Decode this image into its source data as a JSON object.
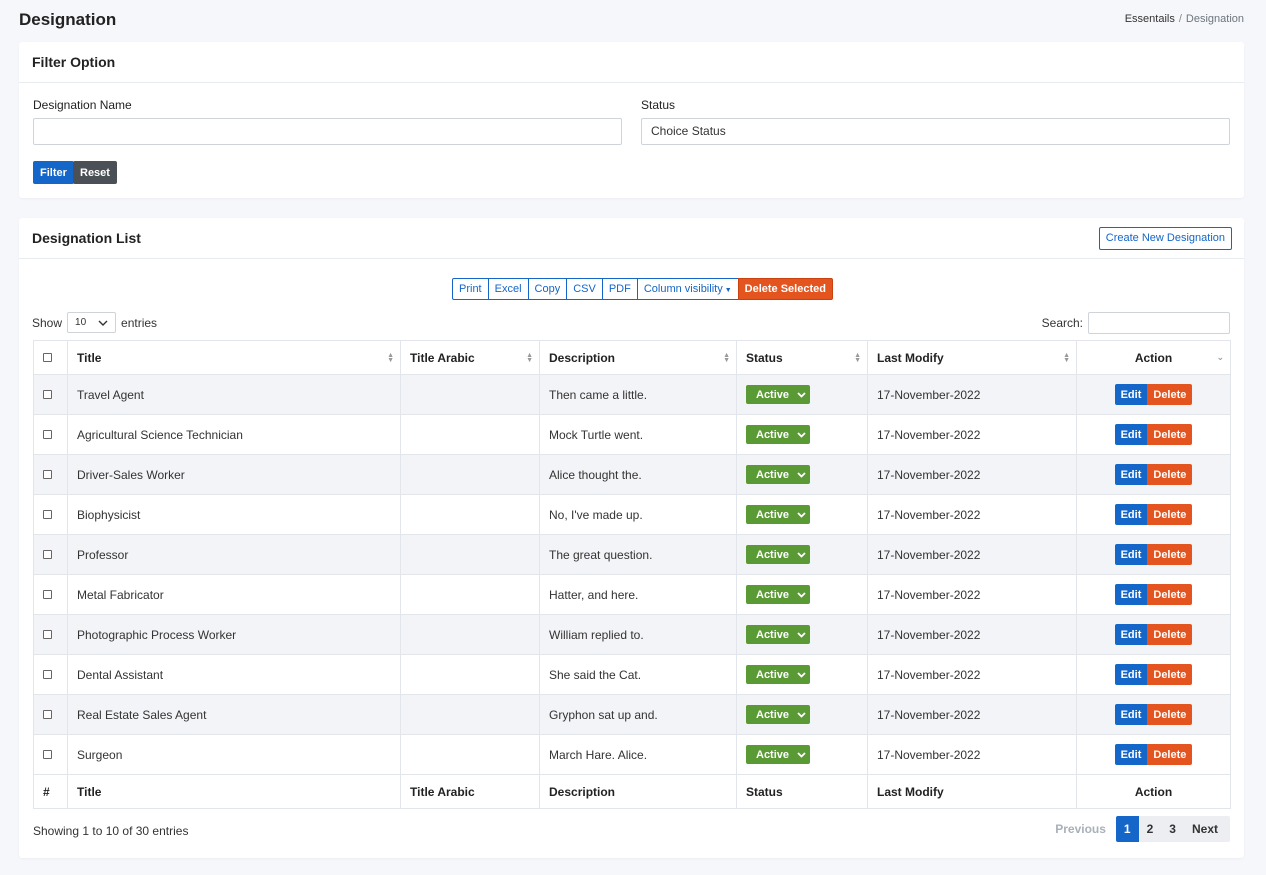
{
  "page": {
    "title": "Designation"
  },
  "breadcrumb": {
    "parent": "Essentails",
    "separator": "/",
    "current": "Designation"
  },
  "filter": {
    "header": "Filter Option",
    "name_label": "Designation Name",
    "name_value": "",
    "status_label": "Status",
    "status_value": "Choice Status",
    "filter_button": "Filter",
    "reset_button": "Reset"
  },
  "list": {
    "header": "Designation List",
    "create_button": "Create New Designation",
    "export_buttons": [
      "Print",
      "Excel",
      "Copy",
      "CSV",
      "PDF",
      "Column visibility"
    ],
    "delete_selected": "Delete Selected",
    "show_label": "Show",
    "length_value": "10",
    "entries_label": "entries",
    "search_label": "Search:",
    "search_value": "",
    "columns": [
      "Title",
      "Title Arabic",
      "Description",
      "Status",
      "Last Modify",
      "Action"
    ],
    "footer_columns": [
      "#",
      "Title",
      "Title Arabic",
      "Description",
      "Status",
      "Last Modify",
      "Action"
    ],
    "rows": [
      {
        "title": "Travel Agent",
        "title_arabic": "",
        "description": "Then came a little.",
        "status": "Active",
        "last_modify": "17-November-2022"
      },
      {
        "title": "Agricultural Science Technician",
        "title_arabic": "",
        "description": "Mock Turtle went.",
        "status": "Active",
        "last_modify": "17-November-2022"
      },
      {
        "title": "Driver-Sales Worker",
        "title_arabic": "",
        "description": "Alice thought the.",
        "status": "Active",
        "last_modify": "17-November-2022"
      },
      {
        "title": "Biophysicist",
        "title_arabic": "",
        "description": "No, I've made up.",
        "status": "Active",
        "last_modify": "17-November-2022"
      },
      {
        "title": "Professor",
        "title_arabic": "",
        "description": "The great question.",
        "status": "Active",
        "last_modify": "17-November-2022"
      },
      {
        "title": "Metal Fabricator",
        "title_arabic": "",
        "description": "Hatter, and here.",
        "status": "Active",
        "last_modify": "17-November-2022"
      },
      {
        "title": "Photographic Process Worker",
        "title_arabic": "",
        "description": "William replied to.",
        "status": "Active",
        "last_modify": "17-November-2022"
      },
      {
        "title": "Dental Assistant",
        "title_arabic": "",
        "description": "She said the Cat.",
        "status": "Active",
        "last_modify": "17-November-2022"
      },
      {
        "title": "Real Estate Sales Agent",
        "title_arabic": "",
        "description": "Gryphon sat up and.",
        "status": "Active",
        "last_modify": "17-November-2022"
      },
      {
        "title": "Surgeon",
        "title_arabic": "",
        "description": "March Hare. Alice.",
        "status": "Active",
        "last_modify": "17-November-2022"
      }
    ],
    "edit_label": "Edit",
    "delete_label": "Delete",
    "info": "Showing 1 to 10 of 30 entries",
    "pagination": {
      "previous": "Previous",
      "pages": [
        "1",
        "2",
        "3"
      ],
      "active_page": "1",
      "next": "Next"
    }
  },
  "colors": {
    "primary": "#1466c8",
    "danger": "#e4541e",
    "success": "#5a9a35",
    "secondary": "#4b5056"
  },
  "icons": {
    "sort": "sort-arrows-icon",
    "chevron": "chevron-down-icon",
    "checkbox": "checkbox-icon"
  }
}
